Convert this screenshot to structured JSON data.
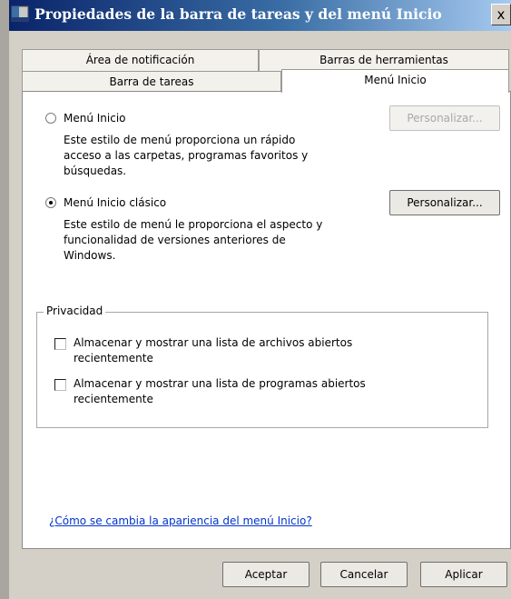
{
  "window": {
    "title": "Propiedades de la barra de tareas y del menú Inicio",
    "close_label": "x"
  },
  "tabs": {
    "row1": [
      "Área de notificación",
      "Barras de herramientas"
    ],
    "row2": [
      "Barra de tareas",
      "Menú Inicio"
    ],
    "active": "Menú Inicio"
  },
  "start_menu": {
    "option_inicio": {
      "label": "Menú Inicio",
      "description": [
        "Este estilo de menú proporciona un rápido",
        "acceso a las carpetas, programas favoritos y",
        "búsquedas."
      ],
      "customize_label": "Personalizar...",
      "selected": false
    },
    "option_clasico": {
      "label": "Menú Inicio clásico",
      "description": [
        "Este estilo de menú le proporciona el aspecto y",
        "funcionalidad de versiones anteriores de",
        "Windows."
      ],
      "customize_label": "Personalizar...",
      "selected": true
    }
  },
  "privacy": {
    "group_label": "Privacidad",
    "items": [
      {
        "lines": [
          "Almacenar y mostrar una lista de archivos abiertos",
          "recientemente"
        ],
        "checked": false
      },
      {
        "lines": [
          "Almacenar y mostrar una lista de programas abiertos",
          "recientemente"
        ],
        "checked": false
      }
    ]
  },
  "help_link": "¿Cómo se cambia la apariencia del menú Inicio?",
  "buttons": {
    "ok": "Aceptar",
    "cancel": "Cancelar",
    "apply": "Aplicar"
  },
  "colors": {
    "title_gradient_start": "#0a246a",
    "title_gradient_end": "#a6caf0",
    "link": "#0033cc"
  }
}
